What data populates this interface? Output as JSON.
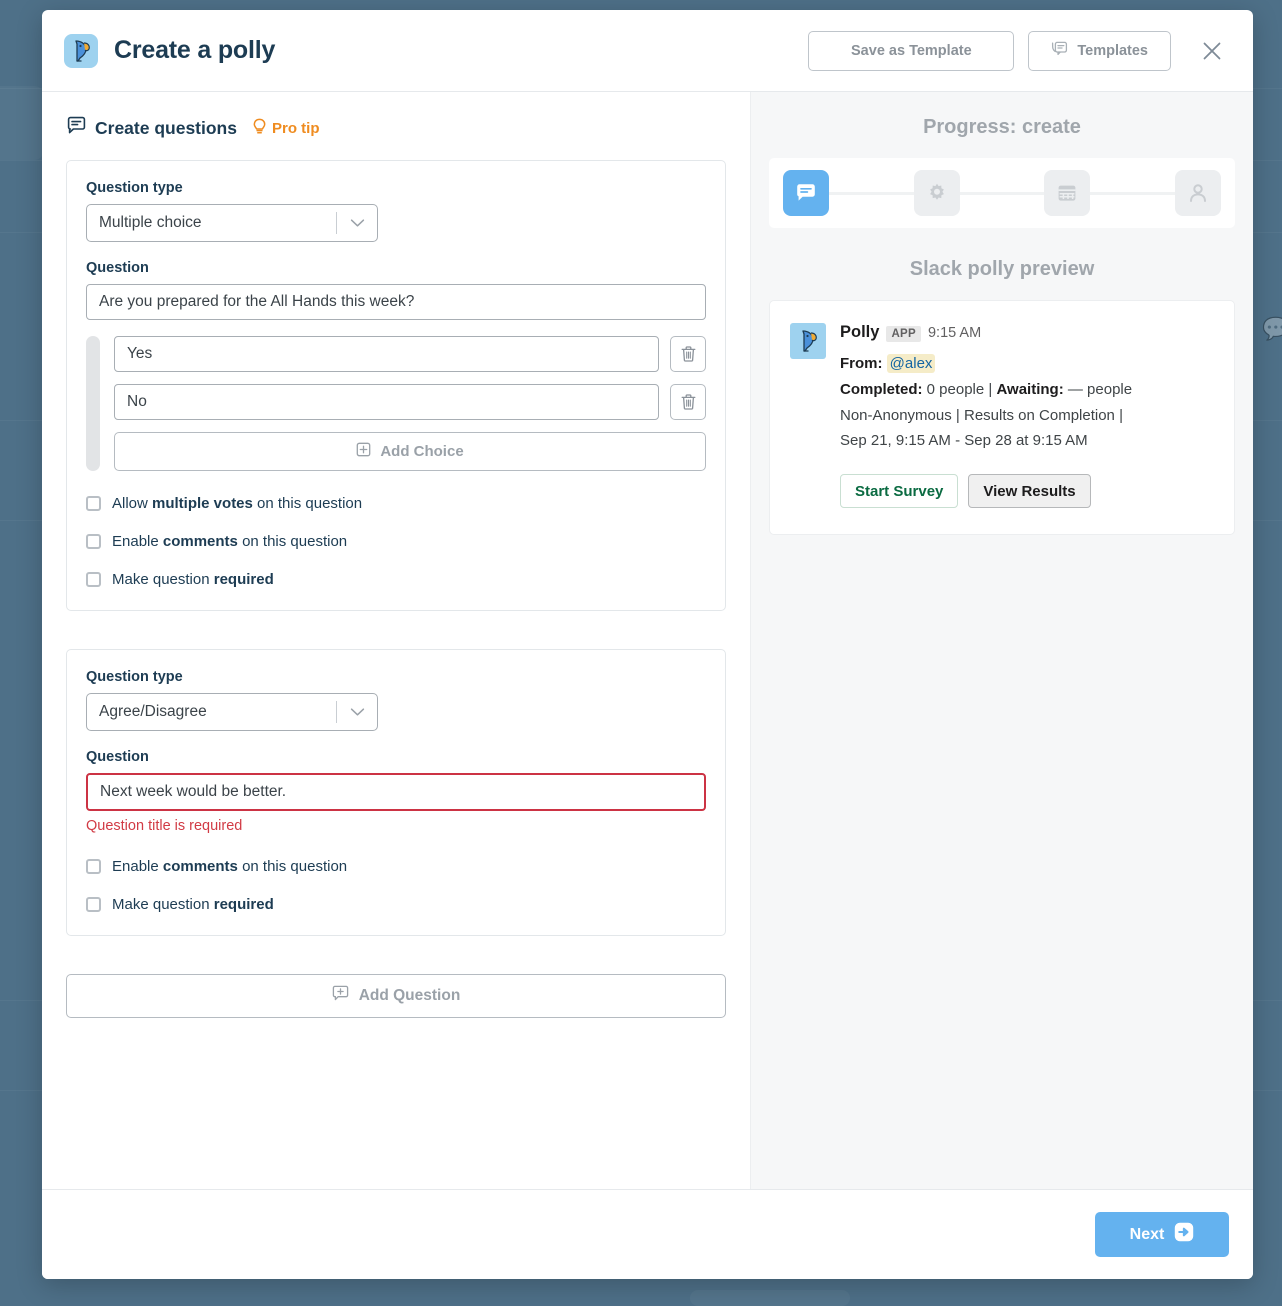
{
  "header": {
    "logo_icon": "polly-parrot-icon",
    "title": "Create a polly",
    "save_template_label": "Save as Template",
    "templates_label": "Templates",
    "templates_icon": "templates-stack-icon",
    "close_icon": "close-icon"
  },
  "left": {
    "section_icon": "speech-bubble-icon",
    "section_title": "Create questions",
    "pro_tip_icon": "lightbulb-icon",
    "pro_tip_label": "Pro tip",
    "add_question_label": "Add Question",
    "add_question_icon": "add-comment-icon",
    "questions": [
      {
        "type_label": "Question type",
        "type_value": "Multiple choice",
        "question_label": "Question",
        "question_value": "Are you prepared for the All Hands this week?",
        "has_error": false,
        "error_text": "",
        "choices": [
          "Yes",
          "No"
        ],
        "add_choice_label": "Add Choice",
        "add_choice_icon": "plus-box-icon",
        "delete_icon": "trash-icon",
        "options": [
          {
            "prefix": "Allow ",
            "strong": "multiple votes",
            "suffix": " on this question",
            "checked": false
          },
          {
            "prefix": "Enable ",
            "strong": "comments",
            "suffix": " on this question",
            "checked": false
          },
          {
            "prefix": "Make question ",
            "strong": "required",
            "suffix": "",
            "checked": false
          }
        ]
      },
      {
        "type_label": "Question type",
        "type_value": "Agree/Disagree",
        "question_label": "Question",
        "question_value": "Next week would be better.",
        "has_error": true,
        "error_text": "Question title is required",
        "choices": [],
        "add_choice_label": "",
        "add_choice_icon": "",
        "delete_icon": "trash-icon",
        "options": [
          {
            "prefix": "Enable ",
            "strong": "comments",
            "suffix": " on this question",
            "checked": false
          },
          {
            "prefix": "Make question ",
            "strong": "required",
            "suffix": "",
            "checked": false
          }
        ]
      }
    ]
  },
  "right": {
    "progress_title": "Progress: create",
    "steps": [
      {
        "icon": "speech-bubble-icon",
        "active": true
      },
      {
        "icon": "gear-icon",
        "active": false
      },
      {
        "icon": "calendar-icon",
        "active": false
      },
      {
        "icon": "person-icon",
        "active": false
      }
    ],
    "preview_title": "Slack polly preview",
    "preview": {
      "avatar_icon": "polly-parrot-icon",
      "author": "Polly",
      "app_badge": "APP",
      "time": "9:15 AM",
      "from_label": "From:",
      "from_value": "@alex",
      "completed_label": "Completed:",
      "completed_value": "0 people",
      "awaiting_label": "Awaiting:",
      "awaiting_value": "— people",
      "separator": "|",
      "anonymity": "Non-Anonymous",
      "results_mode": "Results on Completion",
      "schedule": "Sep 21, 9:15 AM - Sep 28 at 9:15 AM",
      "start_survey_label": "Start Survey",
      "view_results_label": "View Results"
    }
  },
  "footer": {
    "next_label": "Next",
    "next_icon": "arrow-right-circle-icon"
  },
  "colors": {
    "overlay": "#4e7088",
    "accent_blue": "#64b2ef",
    "pro_tip_orange": "#ef8c20",
    "error_red": "#cc3344",
    "heading_navy": "#1d3c53"
  }
}
